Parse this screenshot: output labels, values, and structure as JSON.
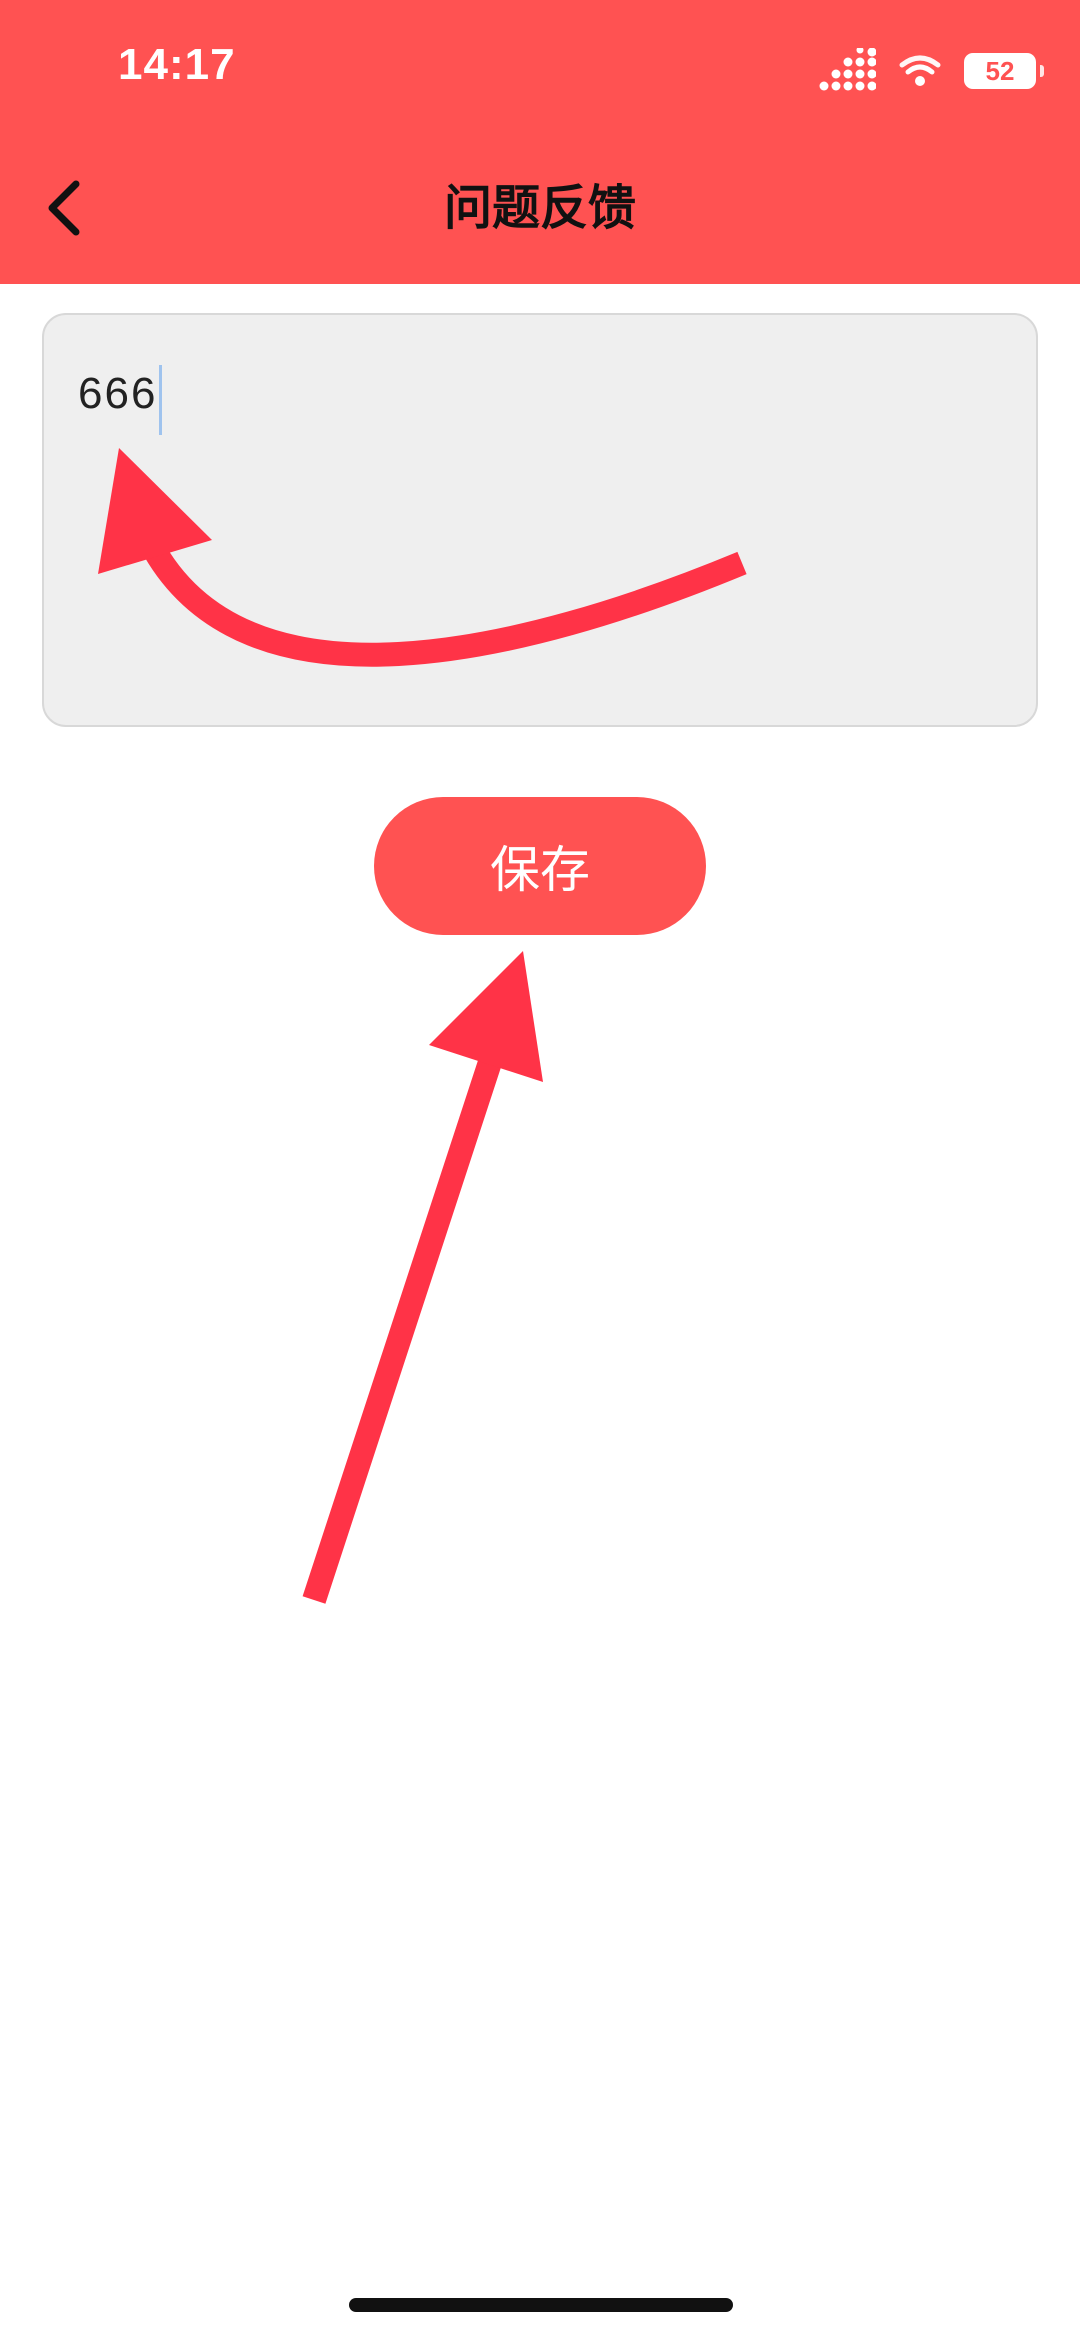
{
  "status_bar": {
    "time": "14:17",
    "battery_level": "52",
    "icons": [
      "signal-icon",
      "wifi-icon",
      "battery-icon"
    ]
  },
  "header": {
    "title": "问题反馈",
    "back_icon": "chevron-left-icon"
  },
  "feedback": {
    "value": "666"
  },
  "actions": {
    "save_label": "保存"
  },
  "annotations": {
    "icons": [
      "curved-arrow-icon",
      "straight-arrow-icon"
    ]
  },
  "colors": {
    "primary": "#FF5252",
    "annotation": "#FF3347",
    "input_background": "#EFEFEF",
    "caret": "#9FC3EE"
  }
}
